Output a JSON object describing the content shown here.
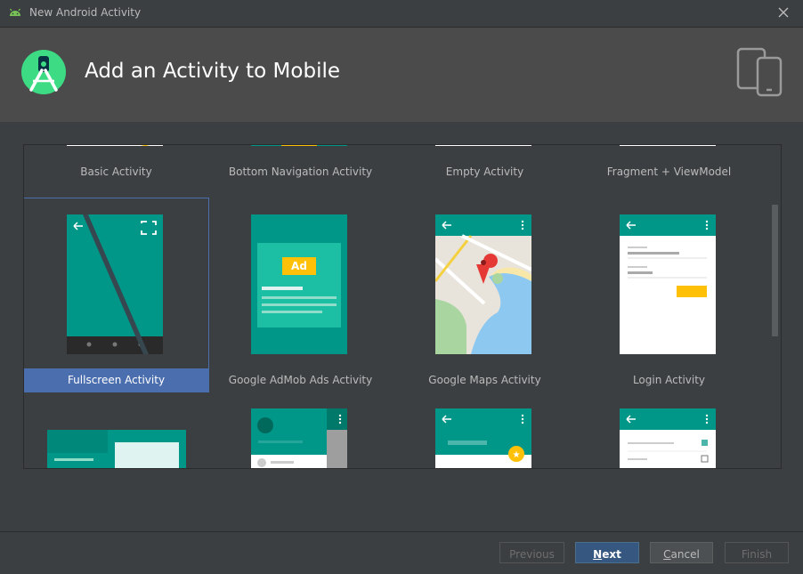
{
  "window": {
    "title": "New Android Activity"
  },
  "header": {
    "heading": "Add an Activity to Mobile"
  },
  "gallery": {
    "row1": [
      "Basic Activity",
      "Bottom Navigation Activity",
      "Empty Activity",
      "Fragment + ViewModel"
    ],
    "row2": [
      "Fullscreen Activity",
      "Google AdMob Ads Activity",
      "Google Maps Activity",
      "Login Activity"
    ],
    "selected": "Fullscreen Activity",
    "ad_badge": "Ad"
  },
  "buttons": {
    "previous": "Previous",
    "next_prefix": "N",
    "next_rest": "ext",
    "cancel_prefix": "C",
    "cancel_rest": "ancel",
    "finish": "Finish"
  },
  "colors": {
    "teal": "#009688",
    "accent": "#ffc107",
    "selection": "#4b6eaf"
  }
}
